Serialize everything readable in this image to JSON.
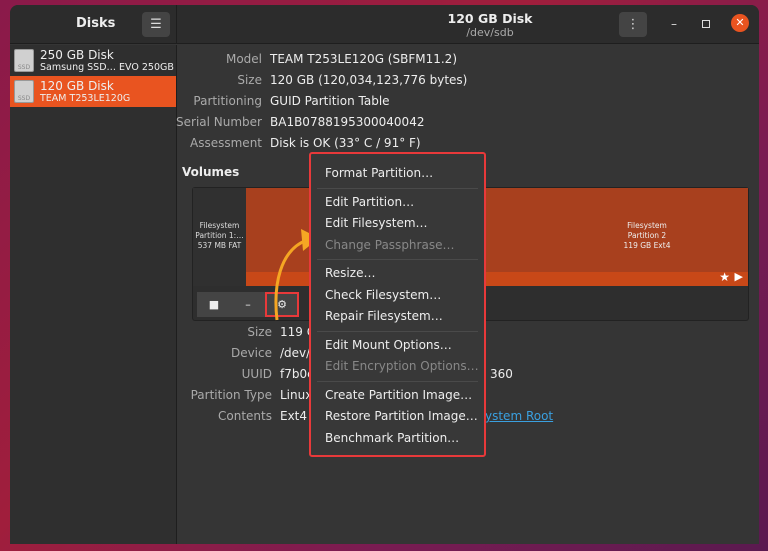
{
  "sidebar": {
    "title": "Disks",
    "menu_icon": "hamburger-icon",
    "disks": [
      {
        "name": "250 GB Disk",
        "sub": "Samsung SSD… EVO 250GB",
        "icon": "ssd"
      },
      {
        "name": "120 GB Disk",
        "sub": "TEAM T253LE120G",
        "icon": "ssd",
        "selected": true
      }
    ]
  },
  "header": {
    "title": "120 GB Disk",
    "subtitle": "/dev/sdb"
  },
  "details": [
    {
      "label": "Model",
      "value": "TEAM T253LE120G (SBFM11.2)"
    },
    {
      "label": "Size",
      "value": "120 GB (120,034,123,776 bytes)"
    },
    {
      "label": "Partitioning",
      "value": "GUID Partition Table"
    },
    {
      "label": "Serial Number",
      "value": "BA1B0788195300040042"
    },
    {
      "label": "Assessment",
      "value": "Disk is OK (33° C / 91° F)"
    }
  ],
  "volumes": {
    "title": "Volumes",
    "p1": {
      "l1": "Filesystem",
      "l2": "Partition 1:…",
      "l3": "537 MB FAT"
    },
    "p2": {
      "l1": "Filesystem",
      "l2": "Partition 2",
      "l3": "119 GB Ext4"
    }
  },
  "partition": [
    {
      "label": "Size",
      "value": "119 C"
    },
    {
      "label": "Device",
      "value": "/dev/"
    },
    {
      "label": "UUID",
      "value": "f7b0c",
      "tail": "360"
    },
    {
      "label": "Partition Type",
      "value": "Linux"
    },
    {
      "label": "Contents",
      "value": "Ext4",
      "link": "ystem Root"
    }
  ],
  "menu": [
    [
      "Format Partition…"
    ],
    [
      "Edit Partition…",
      "Edit Filesystem…",
      "Change Passphrase…"
    ],
    [
      "Resize…",
      "Check Filesystem…",
      "Repair Filesystem…"
    ],
    [
      "Edit Mount Options…",
      "Edit Encryption Options…"
    ],
    [
      "Create Partition Image…",
      "Restore Partition Image…",
      "Benchmark Partition…"
    ]
  ],
  "disabled": [
    "Change Passphrase…",
    "Edit Encryption Options…"
  ],
  "colors": {
    "accent": "#e95420",
    "highlight": "#e8393a",
    "arrow": "#f5a623",
    "link": "#3aa0e0"
  }
}
